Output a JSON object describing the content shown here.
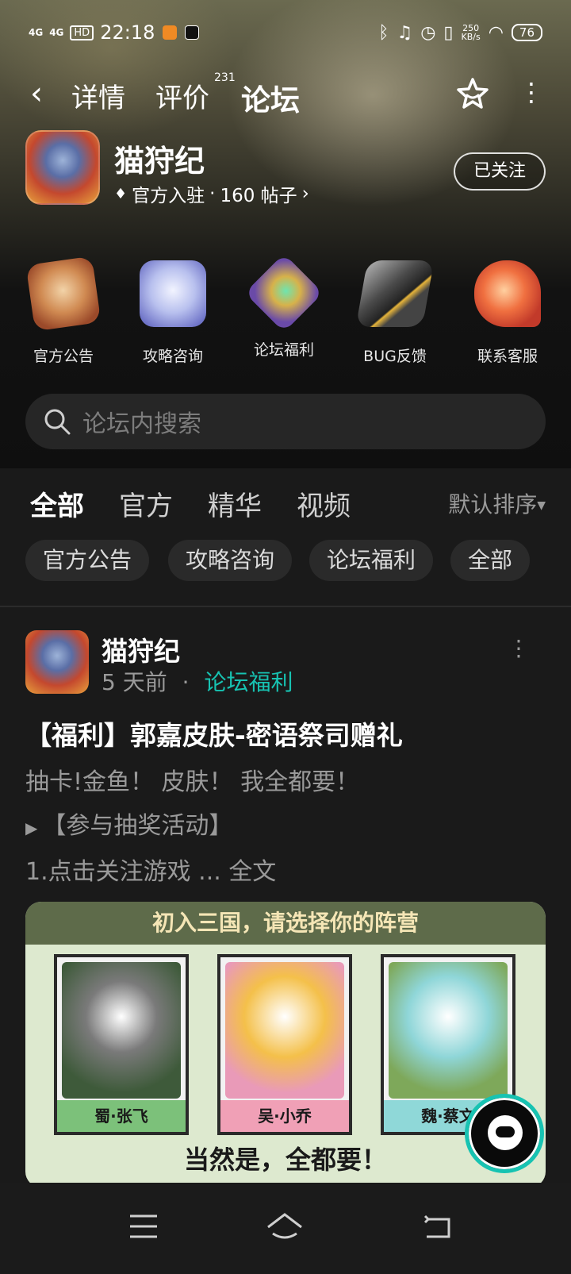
{
  "status_bar": {
    "signal1": "4G",
    "signal2": "4G",
    "hd": "HD",
    "time": "22:18",
    "speed_value": "250",
    "speed_unit": "KB/s",
    "battery": "76"
  },
  "nav": {
    "tabs": [
      "详情",
      "评价",
      "论坛"
    ],
    "review_count": "231",
    "active_tab": "论坛"
  },
  "game": {
    "name": "猫狩纪",
    "meta_official": "官方入驻",
    "meta_dot": "·",
    "meta_posts": "160 帖子",
    "follow_label": "已关注"
  },
  "categories": [
    {
      "label": "官方公告",
      "icon": "announcement-badge-icon"
    },
    {
      "label": "攻略咨询",
      "icon": "paw-shield-icon"
    },
    {
      "label": "论坛福利",
      "icon": "gem-medal-icon"
    },
    {
      "label": "BUG反馈",
      "icon": "cracked-block-icon"
    },
    {
      "label": "联系客服",
      "icon": "koi-fish-icon"
    }
  ],
  "search": {
    "placeholder": "论坛内搜索"
  },
  "filter_tabs": [
    "全部",
    "官方",
    "精华",
    "视频"
  ],
  "sort_label": "默认排序",
  "chips": [
    "官方公告",
    "攻略咨询",
    "论坛福利",
    "全部"
  ],
  "post": {
    "author": "猫狩纪",
    "time": "5 天前",
    "dot": "·",
    "tag": "论坛福利",
    "title": "【福利】郭嘉皮肤-密语祭司赠礼",
    "line1": "抽卡!金鱼！ 皮肤！ 我全都要！",
    "line2": "【参与抽奖活动】",
    "line3": "1.点击关注游戏 ... ",
    "line3_more": "全文"
  },
  "banner": {
    "heading": "初入三国，请选择你的阵营",
    "cards": [
      "蜀·张飞",
      "吴·小乔",
      "魏·蔡文"
    ],
    "footer": "当然是，全都要！"
  },
  "colors": {
    "accent": "#17c3b2",
    "background": "#1a1a1a"
  }
}
